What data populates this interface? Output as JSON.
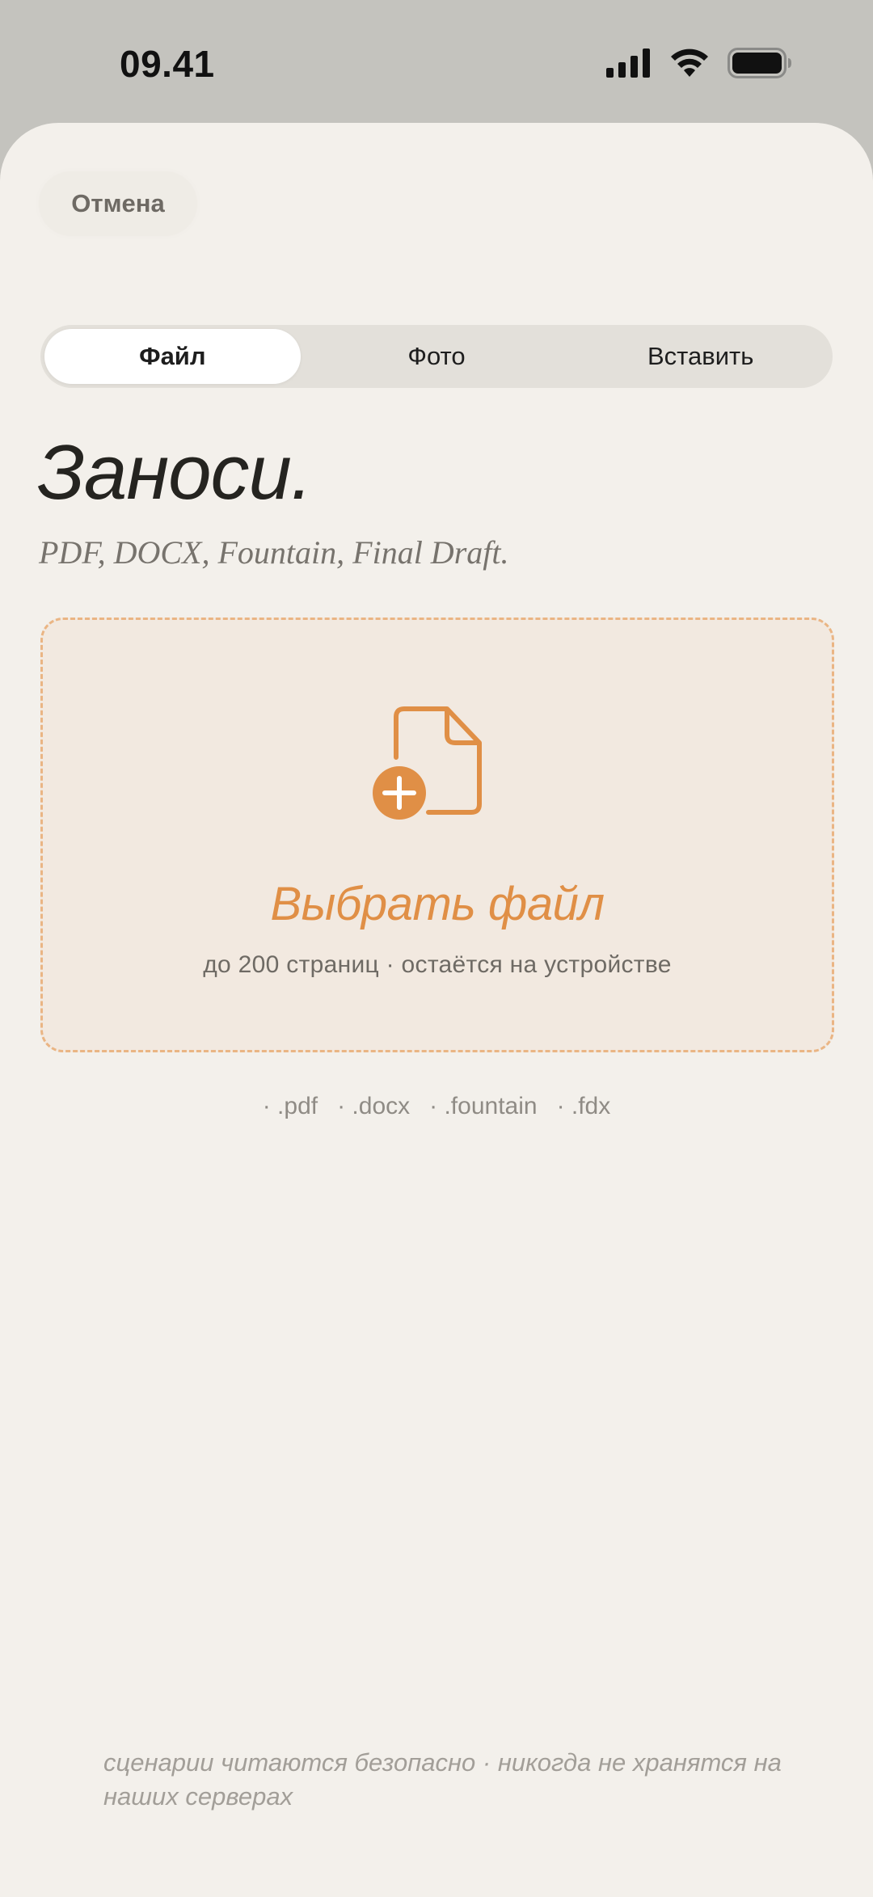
{
  "status_bar": {
    "time": "09.41",
    "icons": [
      "cellular-signal-icon",
      "wifi-icon",
      "battery-icon"
    ]
  },
  "sheet": {
    "cancel_label": "Отмена",
    "tabs": [
      {
        "label": "Файл",
        "active": true
      },
      {
        "label": "Фото",
        "active": false
      },
      {
        "label": "Вставить",
        "active": false
      }
    ],
    "title": "Заноси.",
    "subtitle": "PDF, DOCX, Fountain, Final Draft.",
    "dropzone": {
      "icon": "file-plus-icon",
      "title": "Выбрать файл",
      "subtitle": "до 200 страниц · остаётся на устройстве"
    },
    "formats": [
      "· .pdf",
      "· .docx",
      "· .fountain",
      "· .fdx"
    ],
    "footnote": "сценарии читаются безопасно · никогда не хранятся на наших серверах"
  },
  "colors": {
    "accent": "#E08F46",
    "dropzone_bg": "#F2E9E0",
    "dropzone_border": "#EAB584",
    "sheet_bg": "#F3F0EB",
    "backdrop": "#C4C3BE"
  }
}
